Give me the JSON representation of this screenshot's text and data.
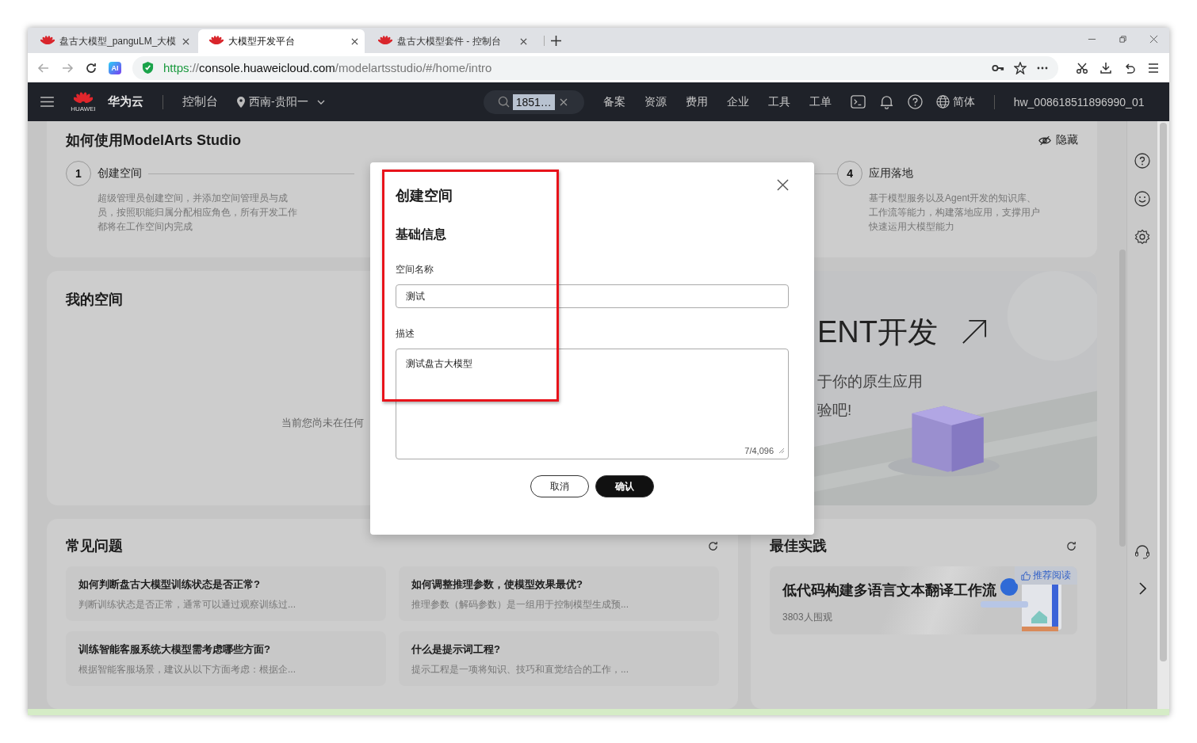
{
  "browser": {
    "tabs": [
      {
        "title": "盘古大模型_panguLM_大模",
        "selected": false
      },
      {
        "title": "大模型开发平台",
        "selected": true
      },
      {
        "title": "盘古大模型套件 - 控制台",
        "selected": false
      }
    ],
    "ai_badge": "AI",
    "url": {
      "scheme": "https",
      "separator": "://",
      "host": "console.huaweicloud.com",
      "path": "/modelartsstudio/#/home/intro"
    }
  },
  "header": {
    "logo_caption": "HUAWEI",
    "brand": "华为云",
    "console": "控制台",
    "region": "西南-贵阳一",
    "search_value": "1851…",
    "nav": [
      "备案",
      "资源",
      "费用",
      "企业",
      "工具",
      "工单"
    ],
    "language": "简体",
    "account": "hw_008618511896990_01"
  },
  "guide": {
    "title": "如何使用ModelArts Studio",
    "hide": "隐藏",
    "steps": [
      {
        "number": "1",
        "title": "创建空间",
        "description": "超级管理员创建空间，并添加空间管理员与成员，按照职能归属分配相应角色，所有开发工作都将在工作空间内完成"
      },
      {
        "number": "4",
        "title": "应用落地",
        "description": "基于模型服务以及Agent开发的知识库、工作流等能力，构建落地应用，支撑用户快速运用大模型能力"
      }
    ]
  },
  "my_space": {
    "title": "我的空间",
    "empty_text": "当前您尚未在任何",
    "banner": {
      "heading": "ENT开发",
      "lines": [
        "于你的原生应用",
        "验吧!"
      ]
    }
  },
  "faq": {
    "title": "常见问题",
    "items": [
      {
        "question": "如何判断盘古大模型训练状态是否正常?",
        "snippet": "判断训练状态是否正常，通常可以通过观察训练过..."
      },
      {
        "question": "如何调整推理参数，使模型效果最优?",
        "snippet": "推理参数（解码参数）是一组用于控制模型生成预..."
      },
      {
        "question": "训练智能客服系统大模型需考虑哪些方面?",
        "snippet": "根据智能客服场景，建议从以下方面考虑：根据企..."
      },
      {
        "question": "什么是提示词工程?",
        "snippet": "提示工程是一项将知识、技巧和直觉结合的工作，..."
      }
    ]
  },
  "best_practice": {
    "title": "最佳实践",
    "items": [
      {
        "title": "低代码构建多语言文本翻译工作流",
        "views": "3803人围观",
        "badge": "推荐阅读"
      }
    ]
  },
  "dialog": {
    "title": "创建空间",
    "section": "基础信息",
    "fields": [
      {
        "kind": "input",
        "label": "空间名称",
        "value": "测试"
      },
      {
        "kind": "textarea",
        "label": "描述",
        "value": "测试盘古大模型",
        "counter": "7/4,096"
      }
    ],
    "buttons": [
      {
        "kind": "secondary",
        "label": "取消"
      },
      {
        "kind": "primary",
        "label": "确认"
      }
    ]
  }
}
